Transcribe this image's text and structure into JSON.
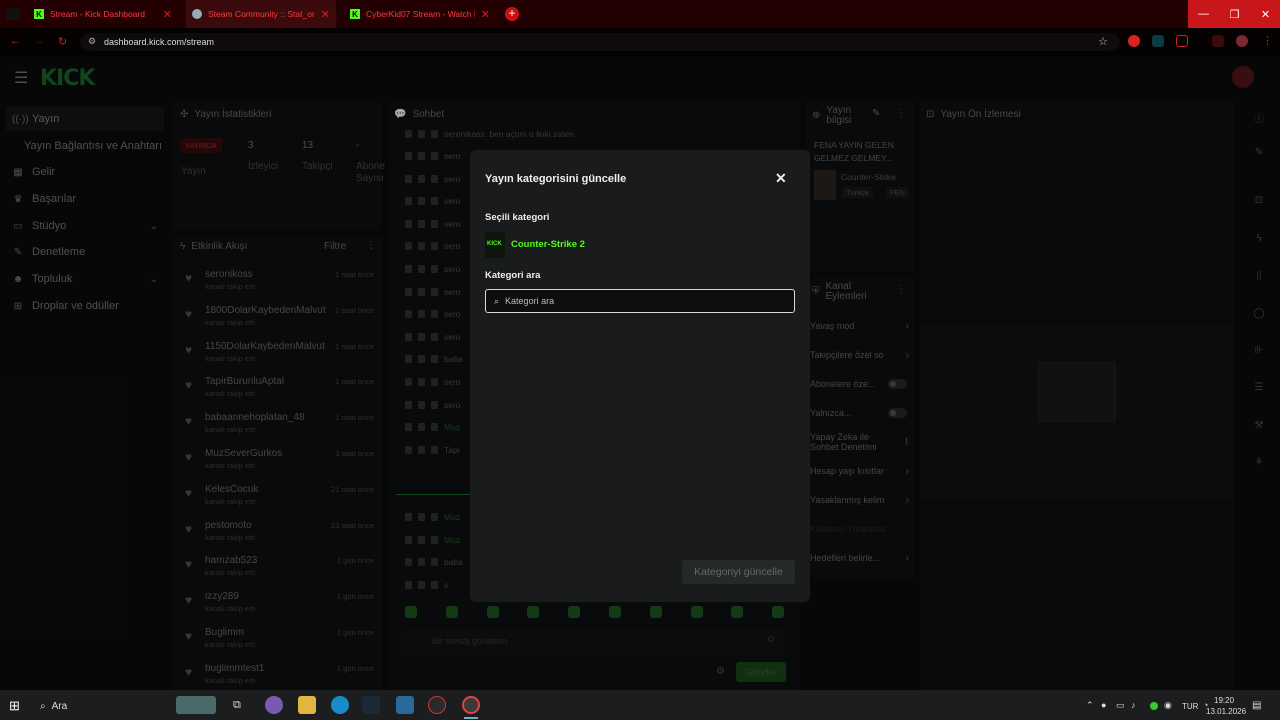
{
  "browser": {
    "tabs": [
      {
        "title": "Stream - Kick Dashboard"
      },
      {
        "title": "Steam Community :: Stat_ori..."
      },
      {
        "title": "CyberKid07 Stream - Watch Li..."
      }
    ],
    "url": "dashboard.kick.com/stream"
  },
  "sidebar": {
    "items": [
      {
        "label": "Yayın",
        "icon": "broadcast-icon"
      },
      {
        "label": "Yayın Bağlantısı ve Anahtarı",
        "icon": ""
      },
      {
        "label": "Gelir",
        "icon": "revenue-icon"
      },
      {
        "label": "Başarılar",
        "icon": "trophy-icon"
      },
      {
        "label": "Stüdyo",
        "icon": "studio-icon"
      },
      {
        "label": "Denetleme",
        "icon": "moderation-icon"
      },
      {
        "label": "Topluluk",
        "icon": "community-icon"
      },
      {
        "label": "Droplar ve ödüller",
        "icon": "drops-icon"
      }
    ]
  },
  "stats": {
    "title": "Yayın İstatistikleri",
    "live_badge": "YAYINDA",
    "viewers": "3",
    "followers": "13",
    "subs": "-",
    "lbl_stream": "Yayın",
    "lbl_viewers": "İzleyici",
    "lbl_followers": "Takipçi",
    "lbl_subs": "Abone Sayısı"
  },
  "activity": {
    "title": "Etkinlik Akışı",
    "filter": "Filtre",
    "items": [
      {
        "user": "seronikoss",
        "sub": "kanalı takip etti",
        "time": "1 saat önce"
      },
      {
        "user": "1800DolarKaybedenMalvut",
        "sub": "kanalı takip etti",
        "time": "1 saat önce"
      },
      {
        "user": "1150DolarKaybedenMalvut",
        "sub": "kanalı takip etti",
        "time": "1 saat önce"
      },
      {
        "user": "TapirBurunluAptal",
        "sub": "kanalı takip etti",
        "time": "1 saat önce"
      },
      {
        "user": "babaannehoplatan_48",
        "sub": "kanalı takip etti",
        "time": "1 saat önce"
      },
      {
        "user": "MuzSeverGurkos",
        "sub": "kanalı takip etti",
        "time": "3 saat önce"
      },
      {
        "user": "KelesCocuk",
        "sub": "kanalı takip etti",
        "time": "21 saat önce"
      },
      {
        "user": "pestomoto",
        "sub": "kanalı takip etti",
        "time": "23 saat önce"
      },
      {
        "user": "hamzab523",
        "sub": "kanalı takip etti",
        "time": "1 gün önce"
      },
      {
        "user": "izzy289",
        "sub": "kanalı takip etti",
        "time": "1 gün önce"
      },
      {
        "user": "Buglimm",
        "sub": "kanalı takip etti",
        "time": "1 gün önce"
      },
      {
        "user": "buglimmtest1",
        "sub": "kanalı takip etti",
        "time": "1 gün önce"
      }
    ]
  },
  "chat": {
    "title": "Sohbet",
    "first_message": "seronikoss: ben açtım o linki zaten",
    "short": [
      "sero",
      "sero",
      "sero",
      "sero",
      "sero",
      "sero",
      "sero",
      "sero",
      "sero",
      "baba",
      "sero",
      "sero",
      "Muz",
      "Tapi"
    ],
    "bottom": [
      "Muz",
      "Muz",
      "baba",
      "s"
    ],
    "placeholder": "Bir mesaj gönderin",
    "send": "Gönder"
  },
  "stream_info": {
    "title": "Yayın bilgisi",
    "stream_title": "FENA YAYIN GELEN GELMEZ GELMEY...",
    "category": "Counter-Strike",
    "tag1": "Türkçe",
    "tag2": "FEN"
  },
  "channel_actions": {
    "title": "Kanal Eylemleri",
    "items": [
      {
        "label": "Yavaş mod",
        "kind": "arrow"
      },
      {
        "label": "Takipçilere özel so",
        "kind": "arrow"
      },
      {
        "label": "Abonelere öze...",
        "kind": "toggle"
      },
      {
        "label": "Yalnızca...",
        "kind": "toggle"
      },
      {
        "label": "Yapay Zeka ile Sohbet Denetimi",
        "kind": "icon"
      },
      {
        "label": "Hesap yaşı kısıtlar",
        "kind": "arrow"
      },
      {
        "label": "Yasaklanmış kelim",
        "kind": "arrow"
      },
      {
        "label": "Kullanıcı Yöneticisi",
        "kind": "none"
      },
      {
        "label": "Hedefleri belirle...",
        "kind": "arrow"
      }
    ]
  },
  "preview": {
    "title": "Yayın Ön İzlemesi"
  },
  "modal": {
    "title": "Yayın kategorisini güncelle",
    "selected_label": "Seçili kategori",
    "selected_category": "Counter-Strike 2",
    "search_label": "Kategori ara",
    "search_placeholder": "Kategori ara",
    "submit": "Kategoriyi güncelle"
  },
  "taskbar": {
    "search": "Ara",
    "lang": "TUR",
    "time": "19:20",
    "date": "13.01.2026"
  },
  "colors": {
    "accent": "#53fc18",
    "page_bg": "#0b0c0d",
    "modal_bg": "#191b1c"
  }
}
